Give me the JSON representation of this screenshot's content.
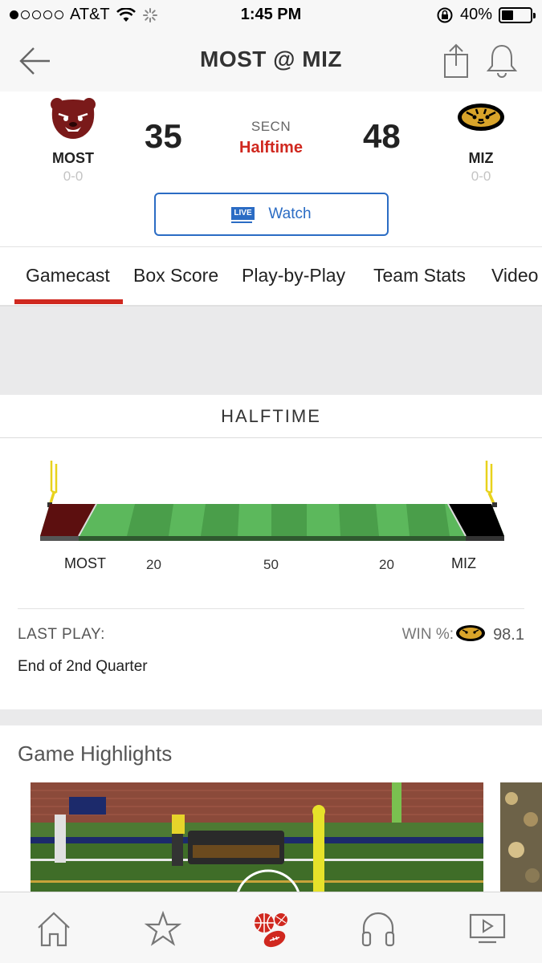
{
  "status_bar": {
    "carrier": "AT&T",
    "time": "1:45 PM",
    "battery": "40%",
    "battery_level": 0.4,
    "signal_bars": 1
  },
  "nav": {
    "title": "MOST @ MIZ"
  },
  "game": {
    "home_team": {
      "abbr": "MOST",
      "record": "0-0",
      "score": "35",
      "color": "#5c0f0f"
    },
    "away_team": {
      "abbr": "MIZ",
      "record": "0-0",
      "score": "48",
      "color": "#000000"
    },
    "network": "SECN",
    "status": "Halftime",
    "watch": {
      "badge": "LIVE",
      "label": "Watch"
    }
  },
  "tabs": [
    {
      "label": "Gamecast",
      "active": true
    },
    {
      "label": "Box Score"
    },
    {
      "label": "Play-by-Play"
    },
    {
      "label": "Team Stats"
    },
    {
      "label": "Video"
    }
  ],
  "field": {
    "period": "HALFTIME",
    "left_endzone": "MOST",
    "right_endzone": "MIZ",
    "yard_labels": [
      "20",
      "50",
      "20"
    ],
    "last_play_label": "LAST PLAY:",
    "last_play": "End of 2nd Quarter",
    "win_label": "WIN %:",
    "win_value": "98.1"
  },
  "highlights": {
    "title": "Game Highlights"
  },
  "colors": {
    "accent_red": "#d0281f",
    "link_blue": "#2b6cc4",
    "field_green_light": "#5cb85c",
    "field_green_dark": "#4a9e4a"
  },
  "tabbar": [
    "home-icon",
    "favorites-star-icon",
    "scores-icon",
    "audio-headphones-icon",
    "video-play-icon"
  ]
}
